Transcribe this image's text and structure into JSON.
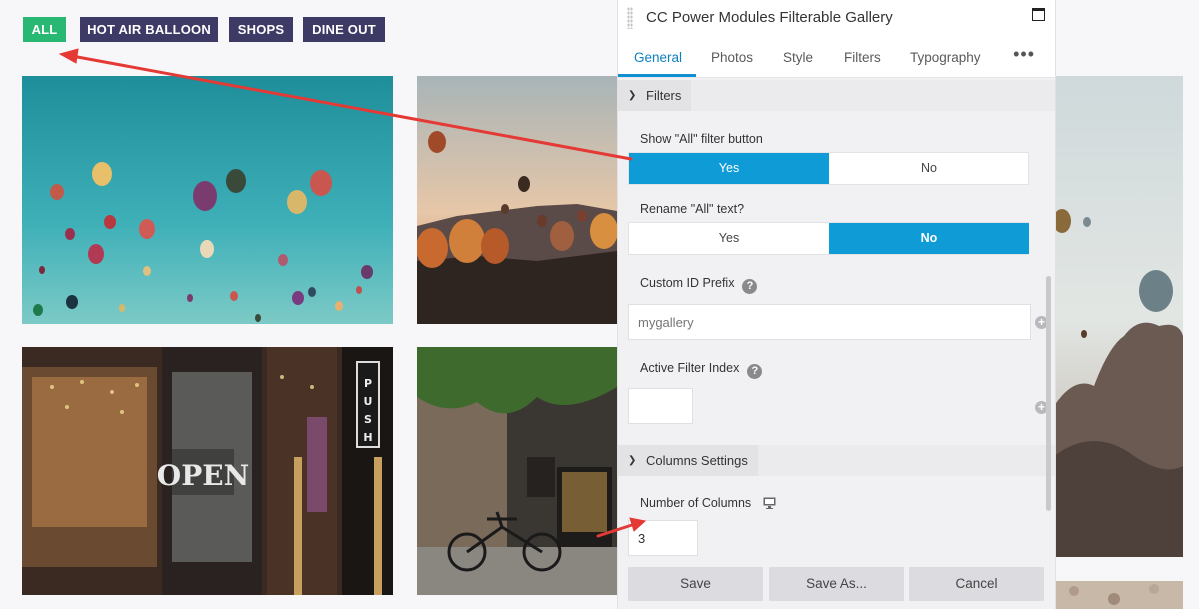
{
  "filters": {
    "buttons": [
      {
        "label": "ALL",
        "active": true
      },
      {
        "label": "HOT AIR BALLOON",
        "active": false
      },
      {
        "label": "SHOPS",
        "active": false
      },
      {
        "label": "DINE OUT",
        "active": false
      }
    ]
  },
  "gallery": {
    "tiles": [
      {
        "subject": "hot air balloons over blue sky"
      },
      {
        "subject": "hot air balloons at sunset over hills"
      },
      {
        "subject": "hot air balloon over rock formations"
      },
      {
        "subject": "shop front with OPEN sign and PUSH door"
      },
      {
        "subject": "bakery street with bicycle"
      }
    ]
  },
  "panel": {
    "title": "CC Power Modules Filterable Gallery",
    "tabs": [
      "General",
      "Photos",
      "Style",
      "Filters",
      "Typography"
    ],
    "active_tab": "General",
    "more_icon": "•••",
    "sections": {
      "filters": {
        "title": "Filters",
        "show_all": {
          "label": "Show \"All\" filter button",
          "options": [
            "Yes",
            "No"
          ],
          "selected": "Yes"
        },
        "rename_all": {
          "label": "Rename \"All\" text?",
          "options": [
            "Yes",
            "No"
          ],
          "selected": "No"
        },
        "custom_id_prefix": {
          "label": "Custom ID Prefix",
          "placeholder": "mygallery",
          "value": ""
        },
        "active_filter_index": {
          "label": "Active Filter Index",
          "value": ""
        }
      },
      "columns": {
        "title": "Columns Settings",
        "number_of_columns": {
          "label": "Number of Columns",
          "value": "3"
        }
      }
    },
    "footer": {
      "save": "Save",
      "save_as": "Save As...",
      "cancel": "Cancel"
    }
  },
  "colors": {
    "filter_active": "#28b873",
    "filter_inactive": "#3e3a66",
    "toggle_on": "#0e9bd6",
    "arrow": "#e53935"
  }
}
